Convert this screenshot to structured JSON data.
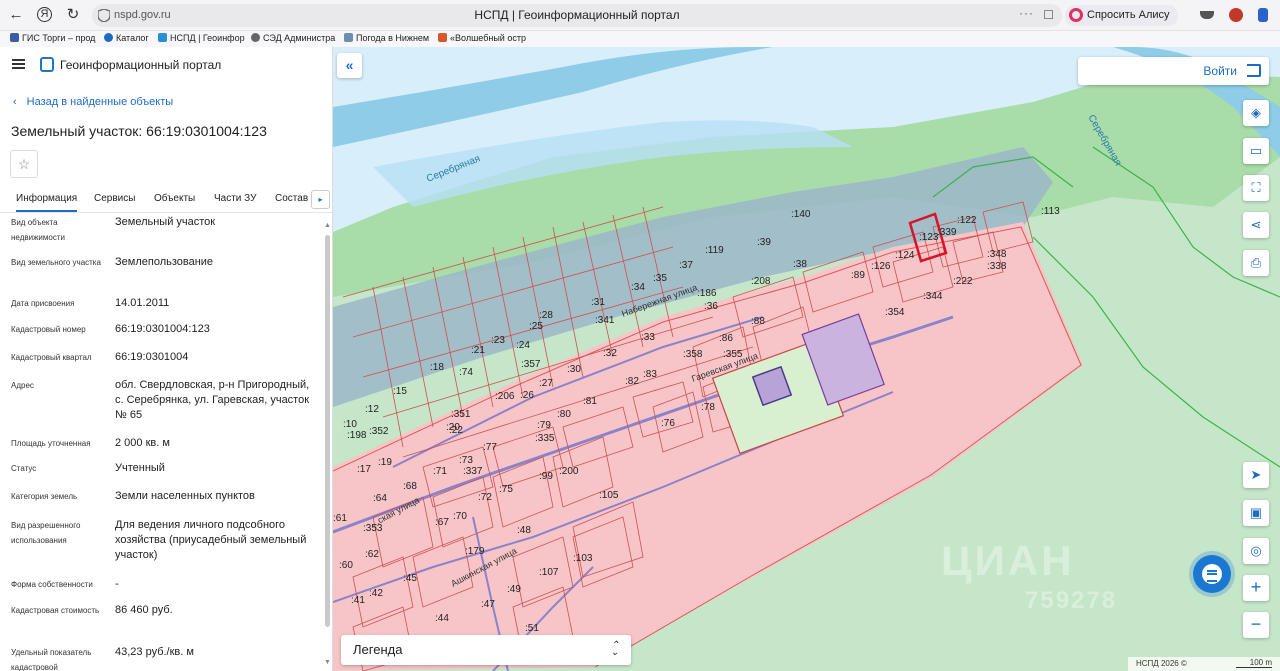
{
  "browser": {
    "url": "nspd.gov.ru",
    "page_title": "НСПД | Геоинформационный портал",
    "more": "···",
    "alice_label": "Спросить Алису AI",
    "bookmarks": [
      "ГИС Торги – прод",
      "Каталог",
      "НСПД | Геоинфор",
      "СЭД Администра",
      "Погода в Нижнем",
      "«Волшебный остр"
    ]
  },
  "portal": {
    "name": "Геоинформационный портал",
    "back_label": "Назад в найденные объекты",
    "object_title": "Земельный участок: 66:19:0301004:123"
  },
  "tabs": [
    {
      "label": "Информация",
      "active": true
    },
    {
      "label": "Сервисы",
      "active": false
    },
    {
      "label": "Объекты",
      "active": false
    },
    {
      "label": "Части ЗУ",
      "active": false
    },
    {
      "label": "Состав",
      "active": false
    }
  ],
  "properties": [
    {
      "label": "Вид объекта недвижимости",
      "value": "Земельный участок"
    },
    {
      "label": "Вид земельного участка",
      "value": "Землепользование"
    },
    {
      "label": "Дата присвоения",
      "value": "14.01.2011"
    },
    {
      "label": "Кадастровый номер",
      "value": "66:19:0301004:123"
    },
    {
      "label": "Кадастровый квартал",
      "value": "66:19:0301004"
    },
    {
      "label": "Адрес",
      "value": "обл. Свердловская, р-н Пригородный, с. Серебрянка, ул. Гаревская, участок № 65"
    },
    {
      "label": "Площадь уточненная",
      "value": "2 000 кв. м"
    },
    {
      "label": "Статус",
      "value": "Учтенный"
    },
    {
      "label": "Категория земель",
      "value": "Земли населенных пунктов"
    },
    {
      "label": "Вид разрешенного использования",
      "value": "Для ведения личного подсобного хозяйства (приусадебный земельный участок)"
    },
    {
      "label": "Форма собственности",
      "value": "-"
    },
    {
      "label": "Кадастровая стоимость",
      "value": "86 460 руб."
    },
    {
      "label": "Удельный показатель кадастровой",
      "value": "43,23 руб./кв. м"
    }
  ],
  "map": {
    "login_label": "Войти",
    "legend_label": "Легенда",
    "attribution": "НСПД 2026 ©",
    "scale_label": "100 m",
    "watermark": "ЦИАН",
    "watermark_phone": "759278",
    "collapse_icon": "double-chevron-left",
    "zoom_in": "+",
    "zoom_out": "−",
    "rivers": [
      "Серебряная",
      "Серебряная"
    ],
    "streets": [
      "Набережная улица",
      "Гаревская улица",
      "Ашкинская улица",
      "...ская улица"
    ],
    "parcels": [
      ":122",
      ":123",
      ":339",
      ":113",
      ":140",
      ":119",
      ":39",
      ":37",
      ":35",
      ":34",
      ":31",
      ":38",
      ":208",
      ":126",
      ":124",
      ":89",
      ":348",
      ":338",
      ":222",
      ":344",
      ":354",
      ":186",
      ":36",
      ":88",
      ":86",
      ":355",
      ":358",
      ":341",
      ":33",
      ":28",
      ":25",
      ":24",
      ":23",
      ":21",
      ":357",
      ":32",
      ":30",
      ":27",
      ":26",
      ":206",
      ":18",
      ":74",
      ":15",
      ":12",
      ":10",
      ":198",
      ":352",
      ":20",
      ":351",
      ":22",
      ":82",
      ":83",
      ":81",
      ":80",
      ":79",
      ":335",
      ":76",
      ":78",
      ":77",
      ":73",
      ":337",
      ":71",
      ":19",
      ":17",
      ":68",
      ":64",
      ":75",
      ":72",
      ":99",
      ":200",
      ":105",
      ":70",
      ":67",
      ":48",
      ":179",
      ":353",
      ":62",
      ":60",
      ":45",
      ":49",
      ":107",
      ":103",
      ":47",
      ":41",
      ":42",
      ":44",
      ":51",
      ":61"
    ],
    "colors": {
      "forest": "#9fd79f",
      "water": "#8fcce8",
      "settlement": "#f7c5c8",
      "selected": "#d8132a",
      "accent": "#1d6bc2"
    }
  }
}
